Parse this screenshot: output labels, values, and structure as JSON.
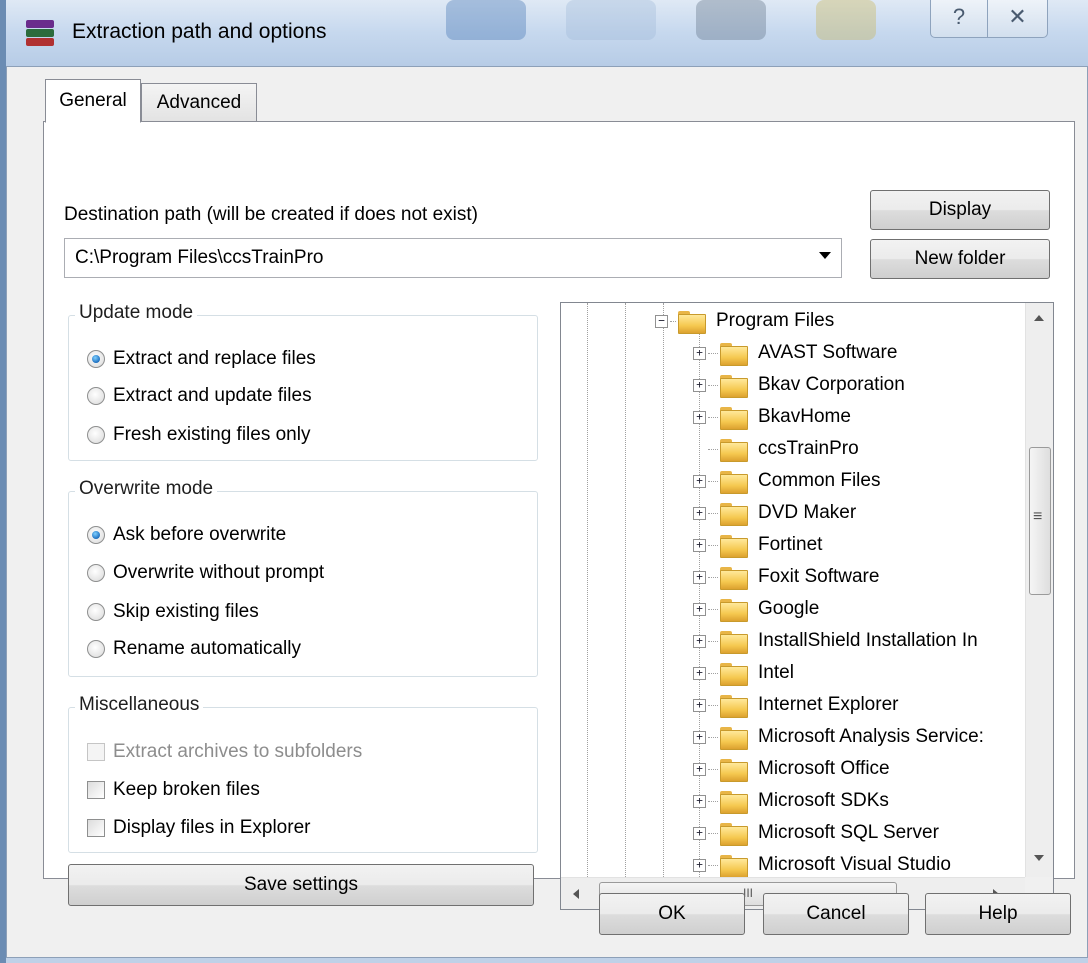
{
  "window": {
    "title": "Extraction path and options",
    "help_glyph": "?",
    "close_glyph": "✕"
  },
  "tabs": [
    {
      "label": "General",
      "selected": true
    },
    {
      "label": "Advanced",
      "selected": false
    }
  ],
  "destination": {
    "label": "Destination path (will be created if does not exist)",
    "value": "C:\\Program Files\\ccsTrainPro",
    "display_button": "Display",
    "new_folder_button": "New folder"
  },
  "update_mode": {
    "title": "Update mode",
    "options": [
      {
        "label": "Extract and replace files",
        "selected": true
      },
      {
        "label": "Extract and update files",
        "selected": false
      },
      {
        "label": "Fresh existing files only",
        "selected": false
      }
    ]
  },
  "overwrite_mode": {
    "title": "Overwrite mode",
    "options": [
      {
        "label": "Ask before overwrite",
        "selected": true
      },
      {
        "label": "Overwrite without prompt",
        "selected": false
      },
      {
        "label": "Skip existing files",
        "selected": false
      },
      {
        "label": "Rename automatically",
        "selected": false
      }
    ]
  },
  "miscellaneous": {
    "title": "Miscellaneous",
    "options": [
      {
        "label": "Extract archives to subfolders",
        "checked": false,
        "enabled": false
      },
      {
        "label": "Keep broken files",
        "checked": false,
        "enabled": true
      },
      {
        "label": "Display files in Explorer",
        "checked": false,
        "enabled": true
      }
    ]
  },
  "save_settings_button": "Save settings",
  "tree": {
    "root": {
      "label": "Program Files",
      "expanded": true,
      "expander": "⊟"
    },
    "children": [
      {
        "label": "AVAST Software",
        "expander": "+"
      },
      {
        "label": "Bkav Corporation",
        "expander": "+"
      },
      {
        "label": "BkavHome",
        "expander": "+"
      },
      {
        "label": "ccsTrainPro",
        "expander": ""
      },
      {
        "label": "Common Files",
        "expander": "+"
      },
      {
        "label": "DVD Maker",
        "expander": "+"
      },
      {
        "label": "Fortinet",
        "expander": "+"
      },
      {
        "label": "Foxit Software",
        "expander": "+"
      },
      {
        "label": "Google",
        "expander": "+"
      },
      {
        "label": "InstallShield Installation In",
        "expander": "+"
      },
      {
        "label": "Intel",
        "expander": "+"
      },
      {
        "label": "Internet Explorer",
        "expander": "+"
      },
      {
        "label": "Microsoft Analysis Service:",
        "expander": "+"
      },
      {
        "label": "Microsoft Office",
        "expander": "+"
      },
      {
        "label": "Microsoft SDKs",
        "expander": "+"
      },
      {
        "label": "Microsoft SQL Server",
        "expander": "+"
      },
      {
        "label": "Microsoft Visual Studio",
        "expander": "+"
      }
    ],
    "scroll_grip": "≡",
    "hscroll_grip": "III"
  },
  "footer": {
    "ok": "OK",
    "cancel": "Cancel",
    "help": "Help"
  }
}
